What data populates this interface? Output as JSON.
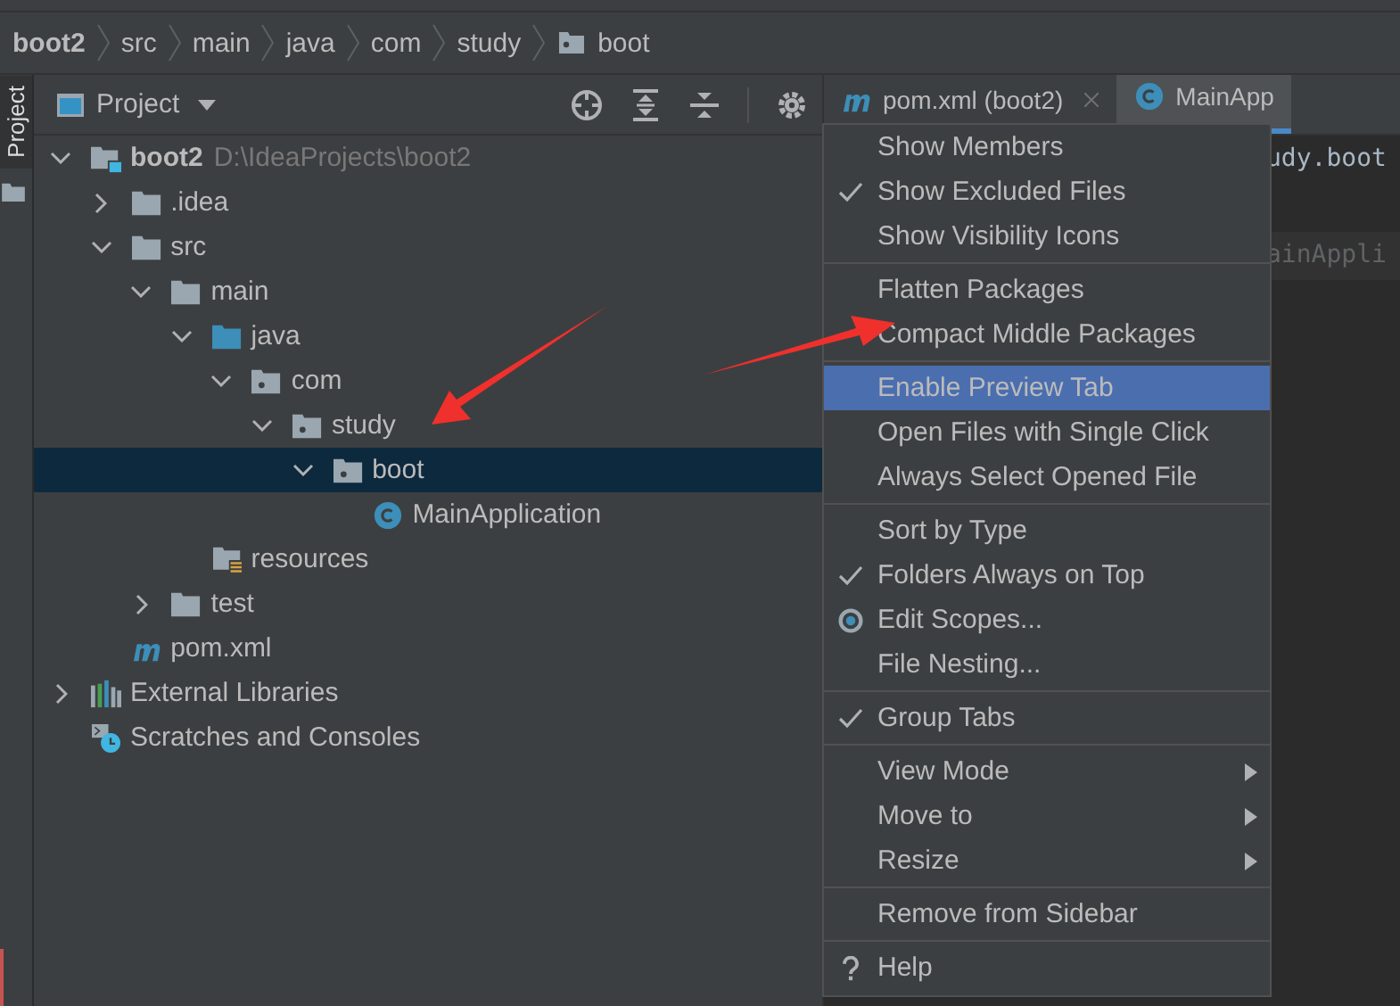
{
  "breadcrumbs": [
    {
      "label": "boot2",
      "kind": "module"
    },
    {
      "label": "src",
      "kind": "dir"
    },
    {
      "label": "main",
      "kind": "dir"
    },
    {
      "label": "java",
      "kind": "dir"
    },
    {
      "label": "com",
      "kind": "dir"
    },
    {
      "label": "study",
      "kind": "dir"
    },
    {
      "label": "boot",
      "kind": "package"
    }
  ],
  "side_tab": {
    "label": "Project",
    "selected": true
  },
  "panel": {
    "title": "Project"
  },
  "tree": [
    {
      "name": "boot2",
      "path": "D:\\IdeaProjects\\boot2",
      "kind": "module",
      "expanded": true,
      "selected": false,
      "children": [
        {
          "name": ".idea",
          "kind": "folder",
          "expanded": false,
          "selected": false
        },
        {
          "name": "src",
          "kind": "folder",
          "expanded": true,
          "selected": false,
          "children": [
            {
              "name": "main",
              "kind": "folder",
              "expanded": true,
              "selected": false,
              "children": [
                {
                  "name": "java",
                  "kind": "source",
                  "expanded": true,
                  "selected": false,
                  "children": [
                    {
                      "name": "com",
                      "kind": "package",
                      "expanded": true,
                      "selected": false,
                      "children": [
                        {
                          "name": "study",
                          "kind": "package",
                          "expanded": true,
                          "selected": false,
                          "children": [
                            {
                              "name": "boot",
                              "kind": "package",
                              "expanded": true,
                              "selected": true,
                              "children": [
                                {
                                  "name": "MainApplication",
                                  "kind": "class",
                                  "selected": false
                                }
                              ]
                            }
                          ]
                        }
                      ]
                    }
                  ]
                },
                {
                  "name": "resources",
                  "kind": "resources",
                  "selected": false
                }
              ]
            },
            {
              "name": "test",
              "kind": "folder",
              "expanded": false,
              "selected": false
            }
          ]
        },
        {
          "name": "pom.xml",
          "kind": "maven",
          "selected": false
        }
      ]
    },
    {
      "name": "External Libraries",
      "kind": "libraries",
      "expanded": false,
      "selected": false
    },
    {
      "name": "Scratches and Consoles",
      "kind": "scratches",
      "selected": false
    }
  ],
  "editor_tabs": [
    {
      "label": "pom.xml (boot2)",
      "kind": "maven",
      "selected": false
    },
    {
      "label": "MainApp",
      "kind": "class",
      "selected": true
    }
  ],
  "editor_lines": [
    {
      "text": "udy.boot",
      "highlighted": false
    },
    {
      "text": "ainAppli",
      "highlighted": true
    }
  ],
  "menu": [
    [
      {
        "label": "Show Members",
        "checked": false,
        "selected": false
      },
      {
        "label": "Show Excluded Files",
        "checked": true,
        "selected": false
      },
      {
        "label": "Show Visibility Icons",
        "checked": false,
        "selected": false
      }
    ],
    [
      {
        "label": "Flatten Packages",
        "checked": false,
        "selected": false
      },
      {
        "label": "Compact Middle Packages",
        "checked": false,
        "selected": false
      }
    ],
    [
      {
        "label": "Enable Preview Tab",
        "checked": false,
        "selected": true
      },
      {
        "label": "Open Files with Single Click",
        "checked": false,
        "selected": false
      },
      {
        "label": "Always Select Opened File",
        "checked": false,
        "selected": false
      }
    ],
    [
      {
        "label": "Sort by Type",
        "checked": false,
        "selected": false
      },
      {
        "label": "Folders Always on Top",
        "checked": true,
        "selected": false
      },
      {
        "label": "Edit Scopes...",
        "checked": false,
        "selected": false,
        "kind": "scope"
      },
      {
        "label": "File Nesting...",
        "checked": false,
        "selected": false
      }
    ],
    [
      {
        "label": "Group Tabs",
        "checked": true,
        "selected": false
      }
    ],
    [
      {
        "label": "View Mode",
        "checked": false,
        "selected": false,
        "submenu": true
      },
      {
        "label": "Move to",
        "checked": false,
        "selected": false,
        "submenu": true
      },
      {
        "label": "Resize",
        "checked": false,
        "selected": false,
        "submenu": true
      }
    ],
    [
      {
        "label": "Remove from Sidebar",
        "checked": false,
        "selected": false
      }
    ],
    [
      {
        "label": "Help",
        "checked": false,
        "selected": false,
        "kind": "help"
      }
    ]
  ]
}
